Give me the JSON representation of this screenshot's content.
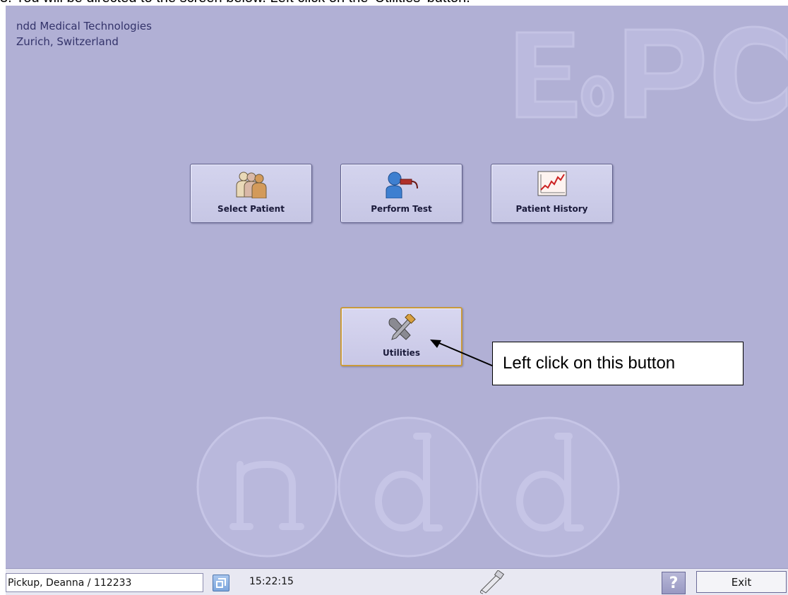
{
  "instruction": "3.   You will be directed to the screen below. Left click on the 'Utilities' button.",
  "company": {
    "name": "ndd Medical Technologies",
    "location": "Zurich, Switzerland"
  },
  "watermarks": {
    "top_right": "EoPC",
    "bottom": "ndd"
  },
  "main_buttons": [
    {
      "label": "Select Patient",
      "icon": "patients-icon"
    },
    {
      "label": "Perform Test",
      "icon": "spirometry-test-icon"
    },
    {
      "label": "Patient History",
      "icon": "history-chart-icon"
    }
  ],
  "utilities_button": {
    "label": "Utilities",
    "icon": "tools-icon",
    "state": "highlighted"
  },
  "callout": {
    "text": "Left click on this button"
  },
  "statusbar": {
    "patient": "Pickup, Deanna / 112233",
    "time": "15:22:15",
    "help_label": "?",
    "exit_label": "Exit"
  },
  "colors": {
    "background": "#b1b0d5",
    "button_face": "#cfcfea",
    "selected_border": "#c99a3a",
    "text_dark": "#33336a"
  }
}
